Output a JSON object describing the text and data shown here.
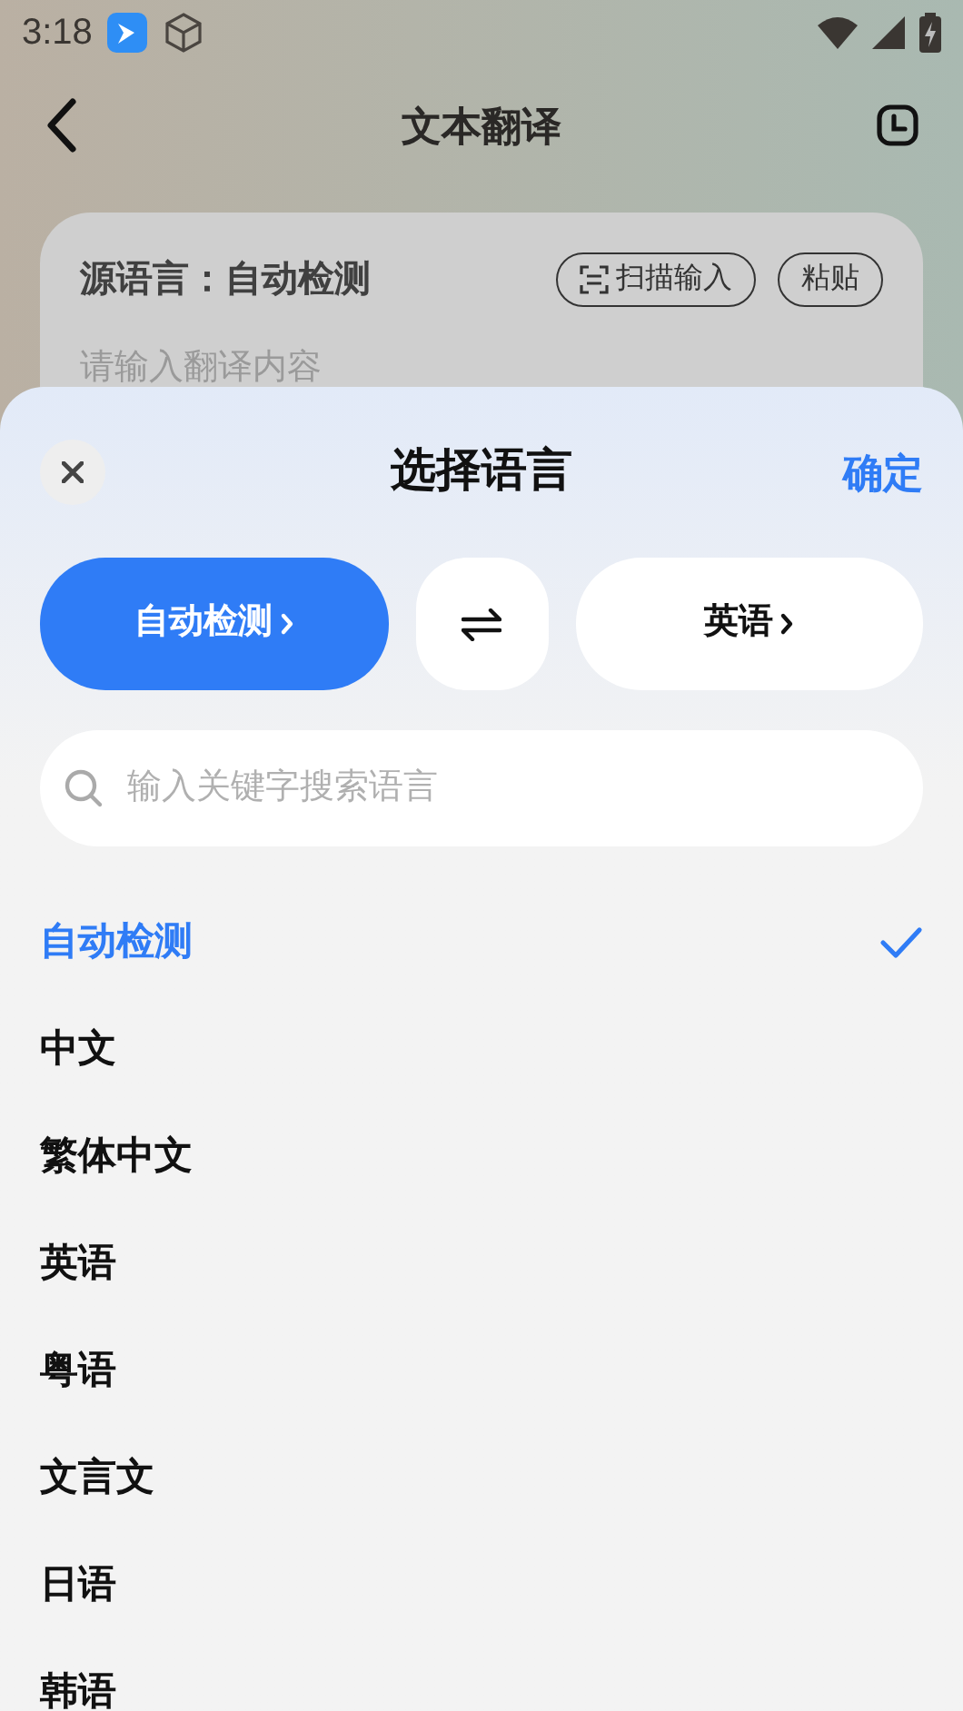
{
  "status_bar": {
    "time": "3:18"
  },
  "header": {
    "title": "文本翻译"
  },
  "input_card": {
    "source_label": "源语言：自动检测",
    "buttons": [
      {
        "kind": "scan",
        "label": "扫描输入"
      },
      {
        "kind": "plain",
        "label": "粘贴"
      }
    ],
    "placeholder": "请输入翻译内容"
  },
  "sheet": {
    "title": "选择语言",
    "confirm": "确定",
    "pair": [
      {
        "label": "自动检测",
        "selected": true
      },
      {
        "label": "英语",
        "selected": false
      }
    ],
    "search": {
      "placeholder": "输入关键字搜索语言"
    },
    "languages": [
      {
        "label": "自动检测",
        "selected": true
      },
      {
        "label": "中文",
        "selected": false
      },
      {
        "label": "繁体中文",
        "selected": false
      },
      {
        "label": "英语",
        "selected": false
      },
      {
        "label": "粤语",
        "selected": false
      },
      {
        "label": "文言文",
        "selected": false
      },
      {
        "label": "日语",
        "selected": false
      },
      {
        "label": "韩语",
        "selected": false
      }
    ]
  }
}
